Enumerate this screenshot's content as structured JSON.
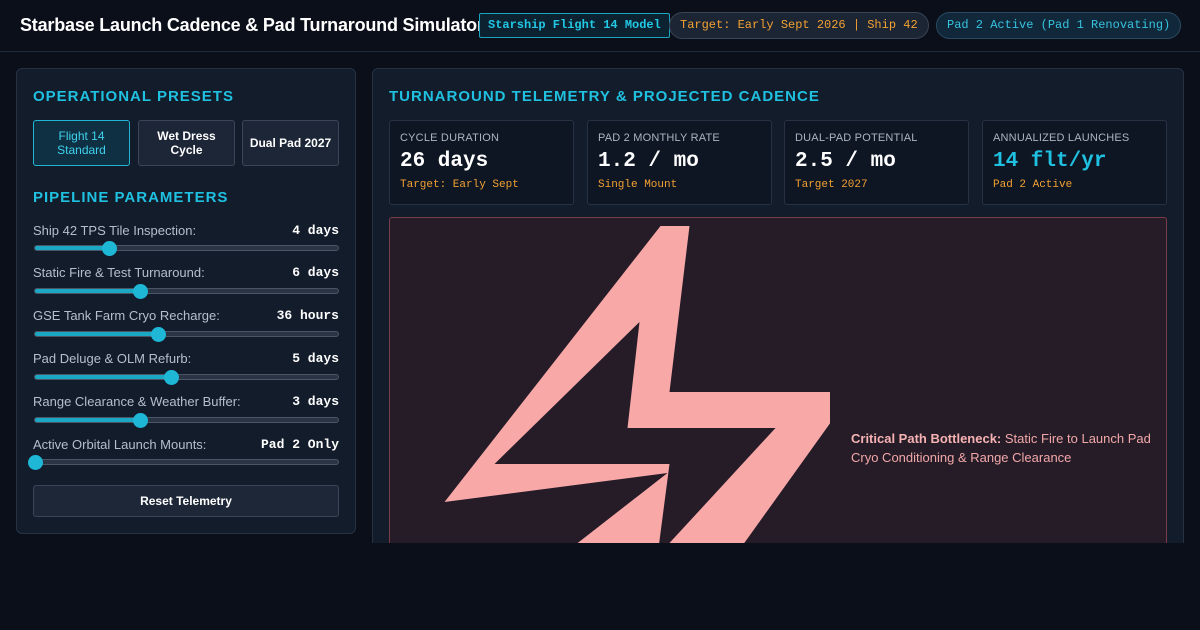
{
  "header": {
    "title": "Starbase Launch Cadence & Pad Turnaround Simulator",
    "model_tag": "Starship Flight 14 Model",
    "target_pill": "Target: Early Sept 2026 | Ship 42",
    "pad_pill": "Pad 2 Active (Pad 1 Renovating)"
  },
  "presets": {
    "title": "OPERATIONAL PRESETS",
    "buttons": [
      {
        "label": "Flight 14 Standard",
        "active": true
      },
      {
        "label": "Wet Dress Cycle",
        "active": false
      },
      {
        "label": "Dual Pad 2027",
        "active": false
      }
    ]
  },
  "pipeline": {
    "title": "PIPELINE PARAMETERS",
    "params": [
      {
        "label": "Ship 42 TPS Tile Inspection:",
        "value": "4 days",
        "level": 0.245
      },
      {
        "label": "Static Fire & Test Turnaround:",
        "value": "6 days",
        "level": 0.345
      },
      {
        "label": "GSE Tank Farm Cryo Recharge:",
        "value": "36 hours",
        "level": 0.405
      },
      {
        "label": "Pad Deluge & OLM Refurb:",
        "value": "5 days",
        "level": 0.45
      },
      {
        "label": "Range Clearance & Weather Buffer:",
        "value": "3 days",
        "level": 0.345
      },
      {
        "label": "Active Orbital Launch Mounts:",
        "value": "Pad 2 Only",
        "level": 0.0
      }
    ],
    "reset_label": "Reset Telemetry"
  },
  "telemetry": {
    "title": "TURNAROUND TELEMETRY & PROJECTED CADENCE",
    "stats": [
      {
        "label": "CYCLE DURATION",
        "value": "26 days",
        "sub": "Target: Early Sept"
      },
      {
        "label": "PAD 2 MONTHLY RATE",
        "value": "1.2 / mo",
        "sub": "Single Mount"
      },
      {
        "label": "DUAL-PAD POTENTIAL",
        "value": "2.5 / mo",
        "sub": "Target 2027"
      },
      {
        "label": "ANNUALIZED LAUNCHES",
        "value": "14 flt/yr",
        "sub": "Pad 2 Active"
      }
    ],
    "alert": {
      "icon": "lightning-bolt-icon",
      "heading": "Critical Path Bottleneck:",
      "body": "Static Fire to Launch Pad Cryo Conditioning & Range Clearance"
    }
  },
  "colors": {
    "accent": "#1fc0e0",
    "warning": "#f2a133",
    "alert_icon": "#f9a8a8",
    "background": "#0a0f1a"
  }
}
